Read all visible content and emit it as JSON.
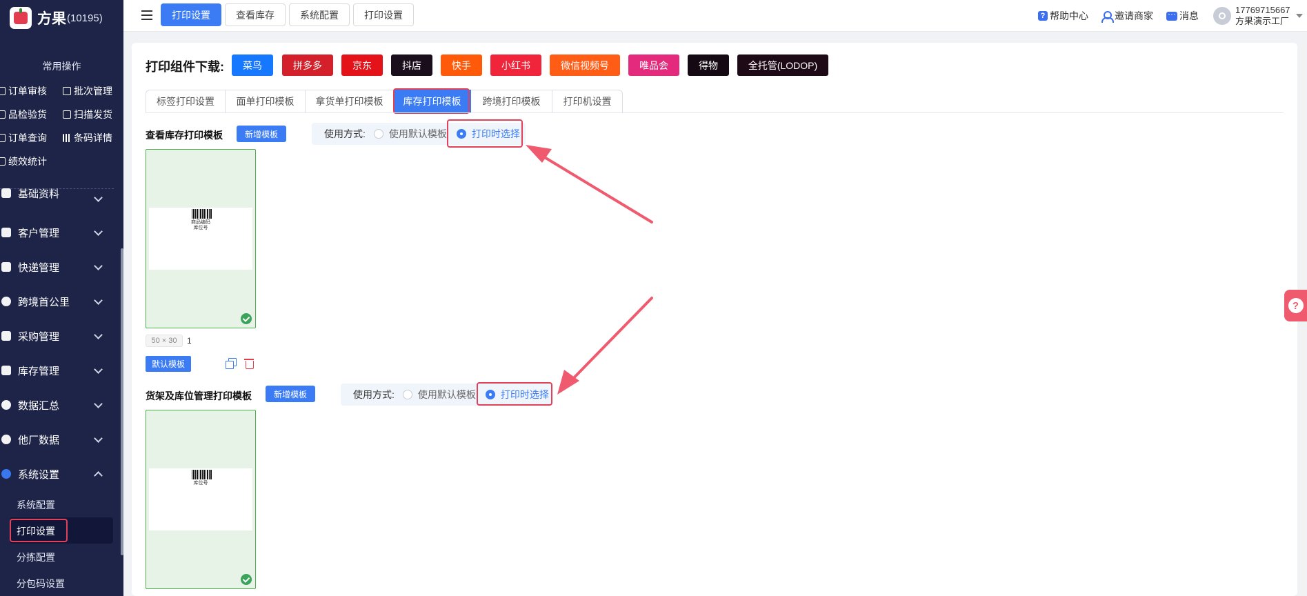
{
  "brand": {
    "name": "方果",
    "id": "(10195)"
  },
  "sidebar": {
    "common_title": "常用操作",
    "quick_ops": [
      {
        "label": "订单审核"
      },
      {
        "label": "批次管理"
      },
      {
        "label": "品检验货"
      },
      {
        "label": "扫描发货"
      },
      {
        "label": "订单查询"
      },
      {
        "label": "条码详情"
      },
      {
        "label": "绩效统计"
      }
    ],
    "menus": [
      {
        "label": "基础资料"
      },
      {
        "label": "客户管理"
      },
      {
        "label": "快递管理"
      },
      {
        "label": "跨境首公里"
      },
      {
        "label": "采购管理"
      },
      {
        "label": "库存管理"
      },
      {
        "label": "数据汇总"
      },
      {
        "label": "他厂数据"
      },
      {
        "label": "系统设置"
      }
    ],
    "sub_items": [
      {
        "label": "系统配置"
      },
      {
        "label": "打印设置"
      },
      {
        "label": "分拣配置"
      },
      {
        "label": "分包码设置"
      }
    ]
  },
  "topbar": {
    "tabs": [
      {
        "label": "打印设置"
      },
      {
        "label": "查看库存"
      },
      {
        "label": "系统配置"
      },
      {
        "label": "打印设置"
      }
    ],
    "help": "帮助中心",
    "invite": "邀请商家",
    "message": "消息",
    "phone": "17769715667",
    "company": "方果演示工厂"
  },
  "download": {
    "title": "打印组件下载:",
    "buttons": [
      {
        "label": "菜鸟",
        "color": "#1677ff"
      },
      {
        "label": "拼多多",
        "color": "#d4202a"
      },
      {
        "label": "京东",
        "color": "#e4131a"
      },
      {
        "label": "抖店",
        "color": "#1b0e1c"
      },
      {
        "label": "快手",
        "color": "#ff5a0a"
      },
      {
        "label": "小红书",
        "color": "#f0243a"
      },
      {
        "label": "微信视频号",
        "color": "#ff5c15"
      },
      {
        "label": "唯品会",
        "color": "#e32a7d"
      },
      {
        "label": "得物",
        "color": "#150a14"
      },
      {
        "label": "全托管(LODOP)",
        "color": "#1d0a16"
      }
    ]
  },
  "tabs": [
    {
      "label": "标签打印设置"
    },
    {
      "label": "面单打印模板"
    },
    {
      "label": "拿货单打印模板"
    },
    {
      "label": "库存打印模板"
    },
    {
      "label": "跨境打印模板"
    },
    {
      "label": "打印机设置"
    }
  ],
  "section1": {
    "title": "查看库存打印模板",
    "add_label": "新增模板",
    "usage_label": "使用方式:",
    "option_default": "使用默认模板",
    "option_select": "打印时选择",
    "paper_line1": "商品编码",
    "paper_line2": "库位号",
    "size": "50 × 30",
    "count": "1",
    "default_label": "默认模板"
  },
  "section2": {
    "title": "货架及库位管理打印模板",
    "add_label": "新增模板",
    "usage_label": "使用方式:",
    "option_default": "使用默认模板",
    "option_select": "打印时选择",
    "paper_line1": "库位号"
  },
  "side_help": "?",
  "colors": {
    "accent": "#3b7cf5",
    "highlight": "#e2415a",
    "sidebar": "#1e2447"
  }
}
